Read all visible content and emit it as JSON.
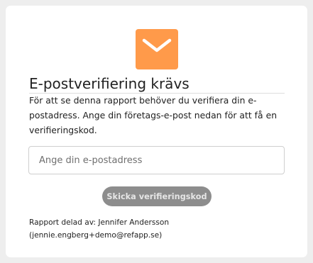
{
  "card": {
    "icon": "envelope-icon",
    "accent_color": "#ff9a4a",
    "heading": "E-postverifiering krävs",
    "description": "För att se denna rapport behöver du verifiera din e-postadress. Ange din företags-e-post nedan för att få en verifieringskod.",
    "email_input": {
      "value": "",
      "placeholder": "Ange din e-postadress"
    },
    "send_button_label": "Skicka verifieringskod",
    "shared_by_line": "Rapport delad av: Jennifer Andersson",
    "shared_by_email": "(jennie.engberg+demo@refapp.se)"
  }
}
